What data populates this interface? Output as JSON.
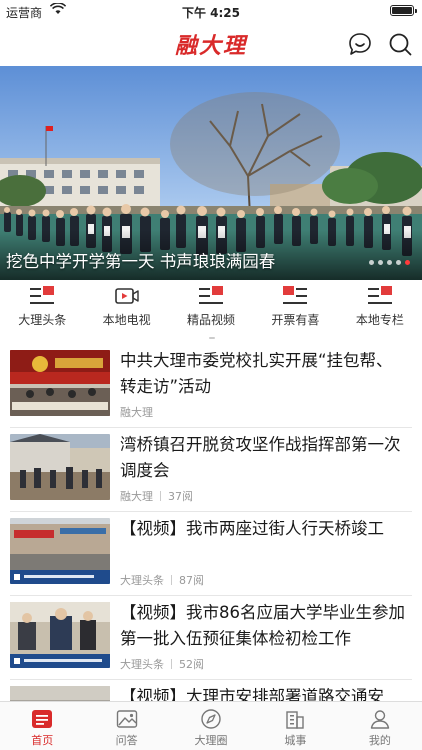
{
  "status_bar": {
    "carrier": "运营商",
    "time": "下午 4:25"
  },
  "header": {
    "brand": "融大理",
    "icons": [
      "chat-icon",
      "search-icon"
    ]
  },
  "banner": {
    "caption": "挖色中学开学第一天 书声琅琅满园春",
    "slide_count": 5,
    "active_slide": 5
  },
  "categories": [
    {
      "label": "大理头条",
      "icon": "news-lines-icon"
    },
    {
      "label": "本地电视",
      "icon": "video-camera-icon"
    },
    {
      "label": "精品视频",
      "icon": "news-lines-icon"
    },
    {
      "label": "开票有喜",
      "icon": "news-lines-icon"
    },
    {
      "label": "本地专栏",
      "icon": "news-lines-icon"
    }
  ],
  "news": [
    {
      "title": "中共大理市委党校扎实开展“挂包帮、转走访”活动",
      "source": "融大理",
      "views": ""
    },
    {
      "title": "湾桥镇召开脱贫攻坚作战指挥部第一次调度会",
      "source": "融大理",
      "views": "37阅"
    },
    {
      "title": "【视频】我市两座过街人行天桥竣工",
      "source": "大理头条",
      "views": "87阅"
    },
    {
      "title": "【视频】我市86名应届大学毕业生参加第一批入伍预征集体检初检工作",
      "source": "大理头条",
      "views": "52阅"
    },
    {
      "title": "【视频】大理市安排部署道路交通安",
      "source": "",
      "views": ""
    }
  ],
  "tabbar": [
    {
      "label": "首页",
      "icon": "home-icon",
      "active": true
    },
    {
      "label": "问答",
      "icon": "image-icon",
      "active": false
    },
    {
      "label": "大理圈",
      "icon": "compass-icon",
      "active": false
    },
    {
      "label": "城事",
      "icon": "building-icon",
      "active": false
    },
    {
      "label": "我的",
      "icon": "user-icon",
      "active": false
    }
  ],
  "colors": {
    "brand_red": "#d92a2a",
    "text": "#1a1a1a",
    "meta": "#999999"
  }
}
